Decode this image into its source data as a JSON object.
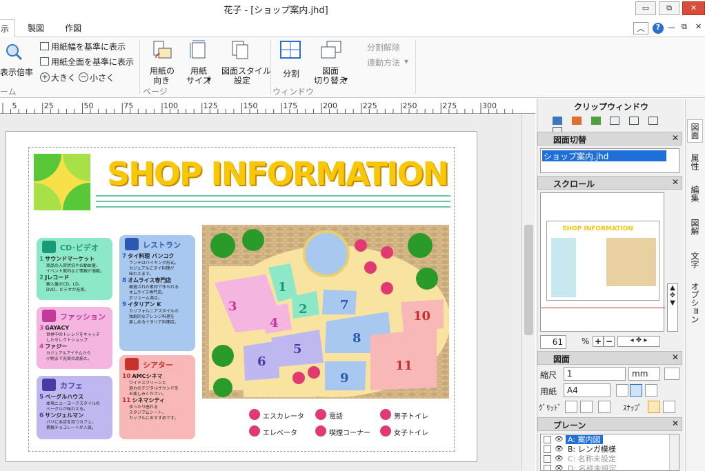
{
  "window": {
    "title": "花子 - [ショップ案内.jhd]",
    "minimize": "▭",
    "restore": "⧉",
    "close": "✕"
  },
  "tabs": [
    "示",
    "製図",
    "作図"
  ],
  "ribbon": {
    "zoom_label": "表示倍率",
    "fit_width": "用紙幅を基準に表示",
    "fit_all": "用紙全面を基準に表示",
    "zoom_in": "大きく",
    "zoom_out": "小さく",
    "group_zoom": "ーム",
    "paper_orientation": [
      "用紙の",
      "向き"
    ],
    "paper_size": [
      "用紙",
      "サイズ"
    ],
    "style_settings": [
      "図面スタイル",
      "設定"
    ],
    "group_page": "ページ",
    "split": "分割",
    "switch": [
      "図面",
      "切り替え"
    ],
    "group_window": "ウィンドウ",
    "unsplit": "分割解除",
    "link_method": "連動方法"
  },
  "ruler": [
    "5",
    "25",
    "50",
    "75",
    "100",
    "125",
    "150",
    "175",
    "200",
    "225",
    "250",
    "275",
    "300"
  ],
  "panel": {
    "clip_window": "クリップウィンドウ",
    "sheet_switch": "図面切替",
    "sheet_file": "ショップ案内.jhd",
    "scroll": "スクロール",
    "zoom_value": "61",
    "zoom_unit": "%",
    "sheet": "図面",
    "scale_label": "縮尺",
    "scale_value": "1",
    "unit": "mm",
    "paper_label": "用紙",
    "paper_value": "A4",
    "grid_label": "ｸﾞﾘｯﾄﾞ",
    "snap_label": "ｽﾅｯﾌﾟ",
    "plane": "プレーン",
    "planes": [
      "A:  案内図",
      "B:  レンガ模様",
      "C:  名称未設定",
      "D:  名称未設定"
    ]
  },
  "sidetabs": [
    "図面",
    "属性",
    "編集",
    "図解",
    "文字",
    "オプション"
  ],
  "doc": {
    "title": "SHOP INFORMATION",
    "cats": [
      {
        "name": "CD･ビデオ",
        "color": "#8de8c8",
        "head": "#1a9a7a",
        "items": [
          [
            "1",
            "サウンドマーケット",
            "商品の入荷状況やお勧め盤、"
          ],
          [
            "",
            "",
            "イベント案内など情報が満載。"
          ],
          [
            "2",
            "Jレコード",
            "輸入盤のCD、LD、"
          ],
          [
            "",
            "",
            "DVD、ビデオが充実。"
          ]
        ]
      },
      {
        "name": "ファッション",
        "color": "#f4b6e0",
        "head": "#c43a9a",
        "items": [
          [
            "3",
            "GAYACY",
            "世界中のトレンドをキャッチ"
          ],
          [
            "",
            "",
            "したセレクトショップ"
          ],
          [
            "4",
            "ファジー",
            "カジュアルアイテムから"
          ],
          [
            "",
            "",
            "小物まで充実の品揃え。"
          ]
        ]
      },
      {
        "name": "カフェ",
        "color": "#bfb8f0",
        "head": "#4a3aa8",
        "items": [
          [
            "5",
            "ベーグルハウス",
            "本場ニューヨークスタイルの"
          ],
          [
            "",
            "",
            "ベーグルが味わえる。"
          ],
          [
            "6",
            "サンジェルマン",
            "パリに本店を持つカフェ。"
          ],
          [
            "",
            "",
            "素敵チョコレートが人気。"
          ]
        ]
      },
      {
        "name": "レストラン",
        "color": "#a8c8f0",
        "head": "#2a5ab0",
        "items": [
          [
            "7",
            "タイ料理 バンコク",
            "ランチはバイキング形式。"
          ],
          [
            "",
            "",
            "カジュアルにタイ料理が"
          ],
          [
            "",
            "",
            "味わえます。"
          ],
          [
            "8",
            "オムライス専門店",
            "厳選された素材で作られる"
          ],
          [
            "",
            "",
            "オムライス専門店。"
          ],
          [
            "",
            "",
            "ボリューム満点。"
          ],
          [
            "9",
            "イタリアン K",
            "カリフォルニアスタイルの"
          ],
          [
            "",
            "",
            "独創的なアレンジ料理を"
          ],
          [
            "",
            "",
            "楽しめるイタリア料理店。"
          ]
        ]
      },
      {
        "name": "シアター",
        "color": "#f8b8b8",
        "head": "#c8302a",
        "items": [
          [
            "10",
            "AMCシネマ",
            "ワイドスクリーンと"
          ],
          [
            "",
            "",
            "迫力のデジタルサウンドを"
          ],
          [
            "",
            "",
            "お楽しみください。"
          ],
          [
            "11",
            "シネマシティ",
            "ゆったり座れる"
          ],
          [
            "",
            "",
            "スタジアムシート。"
          ],
          [
            "",
            "",
            "カップルにおすすめです。"
          ]
        ]
      }
    ],
    "legend": [
      "エスカレータ",
      "電話",
      "男子トイレ",
      "エレベータ",
      "喫煙コーナー",
      "女子トイレ"
    ]
  },
  "colors": {
    "ribbon_bg": "#f9f9f9",
    "panel_bg": "#f0f0f0",
    "selection": "#1e6fd9",
    "title_yellow": "#f8c808"
  }
}
